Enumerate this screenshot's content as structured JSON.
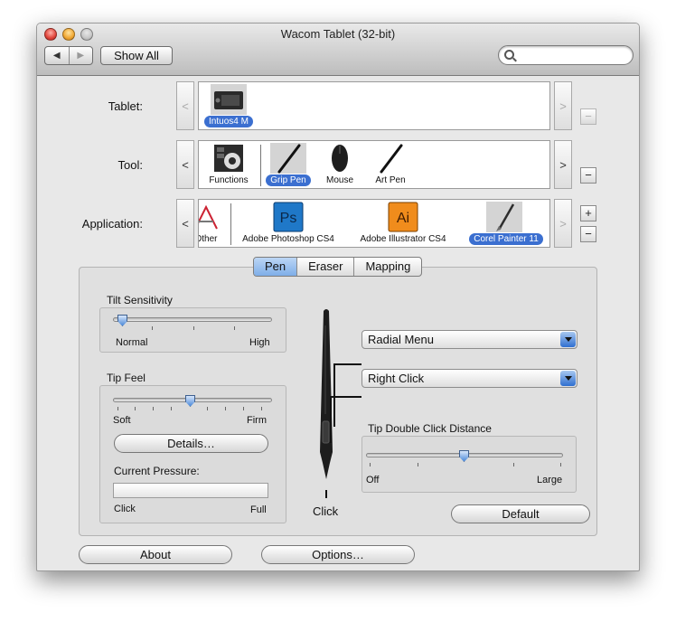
{
  "window": {
    "title": "Wacom Tablet (32-bit)"
  },
  "toolbar": {
    "back_label": "◀",
    "forward_label": "▶",
    "show_all_label": "Show All",
    "search_placeholder": ""
  },
  "rows": {
    "tablet": {
      "label": "Tablet:",
      "left_arrow": "<",
      "right_arrow": ">",
      "remove_label": "−",
      "items": [
        {
          "name": "Intuos4 M",
          "selected": true
        }
      ]
    },
    "tool": {
      "label": "Tool:",
      "left_arrow": "<",
      "right_arrow": ">",
      "remove_label": "−",
      "items": [
        {
          "name": "Functions",
          "selected": false
        },
        {
          "name": "Grip Pen",
          "selected": true
        },
        {
          "name": "Mouse",
          "selected": false
        },
        {
          "name": "Art Pen",
          "selected": false
        }
      ]
    },
    "application": {
      "label": "Application:",
      "left_arrow": "<",
      "right_arrow": ">",
      "add_label": "+",
      "remove_label": "−",
      "items": [
        {
          "name": "Other",
          "visible_text": "Other",
          "selected": false
        },
        {
          "name": "Adobe Photoshop CS4",
          "icon_text": "Ps",
          "selected": false
        },
        {
          "name": "Adobe Illustrator CS4",
          "icon_text": "Ai",
          "selected": false
        },
        {
          "name": "Corel Painter 11",
          "selected": true
        }
      ]
    }
  },
  "tabs": [
    {
      "label": "Pen",
      "active": true
    },
    {
      "label": "Eraser",
      "active": false
    },
    {
      "label": "Mapping",
      "active": false
    }
  ],
  "pen": {
    "tilt_sensitivity": {
      "label": "Tilt Sensitivity",
      "min_label": "Normal",
      "max_label": "High",
      "value": 0.0
    },
    "tip_feel": {
      "label": "Tip Feel",
      "min_label": "Soft",
      "max_label": "Firm",
      "value": 0.5,
      "details_label": "Details…"
    },
    "current_pressure": {
      "label": "Current Pressure:",
      "min_label": "Click",
      "max_label": "Full",
      "value": 0.0
    },
    "upper_button": "Radial Menu",
    "lower_button": "Right Click",
    "tip_label": "Click",
    "tip_double_click": {
      "label": "Tip Double Click Distance",
      "min_label": "Off",
      "max_label": "Large",
      "value": 0.5
    },
    "default_label": "Default"
  },
  "footer": {
    "about_label": "About",
    "options_label": "Options…"
  },
  "colors": {
    "accent": "#3b6fd0",
    "ps_icon": "#1f78c8",
    "ai_icon": "#f08c1c"
  }
}
